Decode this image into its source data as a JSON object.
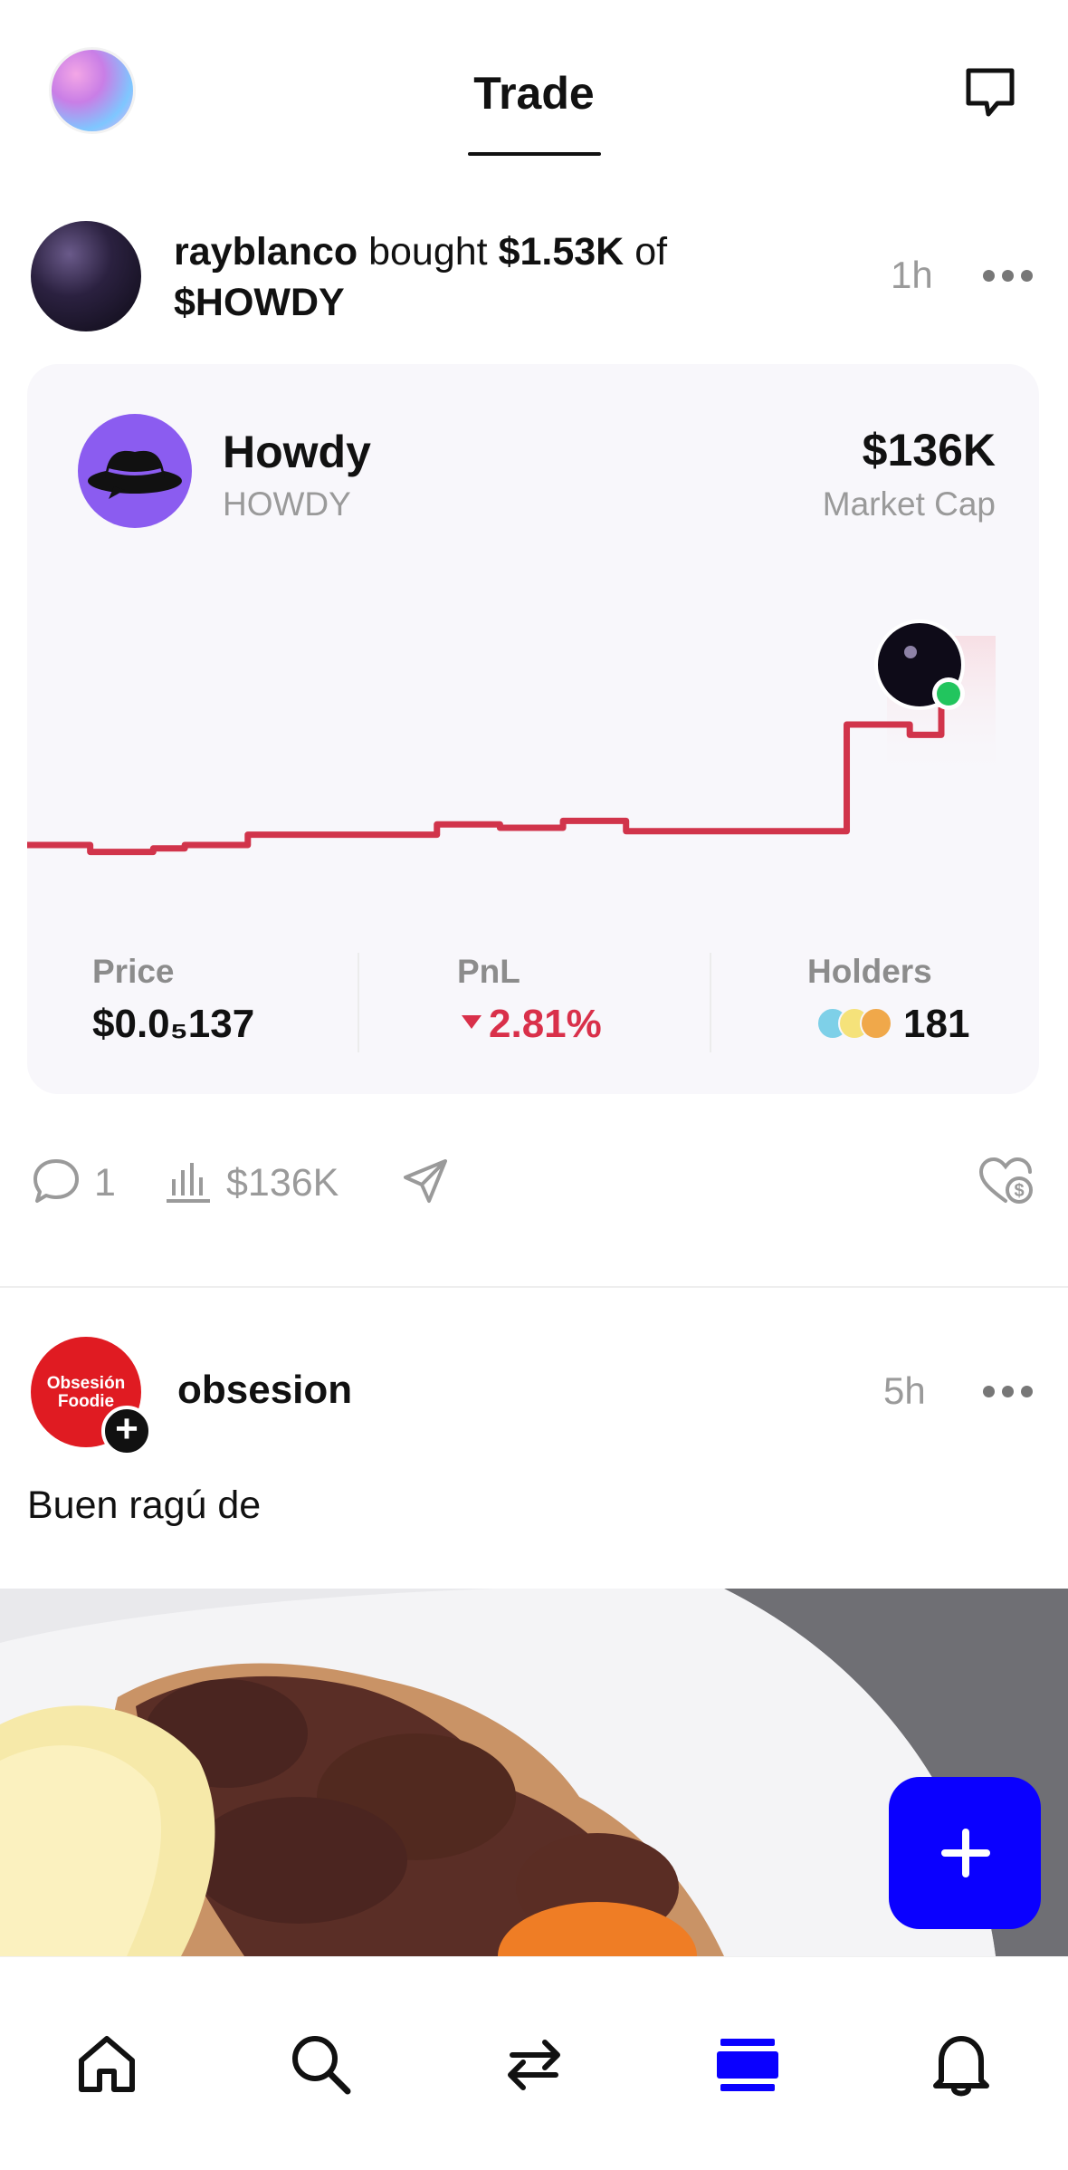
{
  "header": {
    "title": "Trade"
  },
  "post1": {
    "username": "rayblanco",
    "action": "bought",
    "amount": "$1.53K",
    "of_word": "of",
    "token_ticker": "$HOWDY",
    "time": "1h",
    "token": {
      "name": "Howdy",
      "symbol": "HOWDY",
      "market_cap_value": "$136K",
      "market_cap_label": "Market Cap"
    },
    "chart_data": {
      "type": "line",
      "title": "",
      "xlabel": "",
      "ylabel": "",
      "color": "#d1344b",
      "y": [
        1.0,
        1.0,
        0.98,
        0.98,
        0.99,
        1.0,
        1.0,
        1.03,
        1.03,
        1.03,
        1.03,
        1.03,
        1.03,
        1.06,
        1.06,
        1.05,
        1.05,
        1.07,
        1.07,
        1.04,
        1.04,
        1.04,
        1.04,
        1.04,
        1.04,
        1.04,
        1.35,
        1.35,
        1.32,
        1.4
      ],
      "grid": false,
      "legend": "none"
    },
    "stats": {
      "price_label": "Price",
      "price_value": "$0.0₅137",
      "pnl_label": "PnL",
      "pnl_value": "2.81%",
      "holders_label": "Holders",
      "holders_value": "181"
    },
    "actions": {
      "comments": "1",
      "volume": "$136K"
    }
  },
  "post2": {
    "username": "obsesion",
    "avatar_text": "Obsesión Foodie",
    "time": "5h",
    "body": "Buen ragú de"
  },
  "colors": {
    "accent": "#0a00ff",
    "pnl_negative": "#d9304a",
    "online": "#22c55e"
  },
  "nav": [
    "home-icon",
    "search-icon",
    "swap-icon",
    "feed-icon",
    "bell-icon"
  ]
}
